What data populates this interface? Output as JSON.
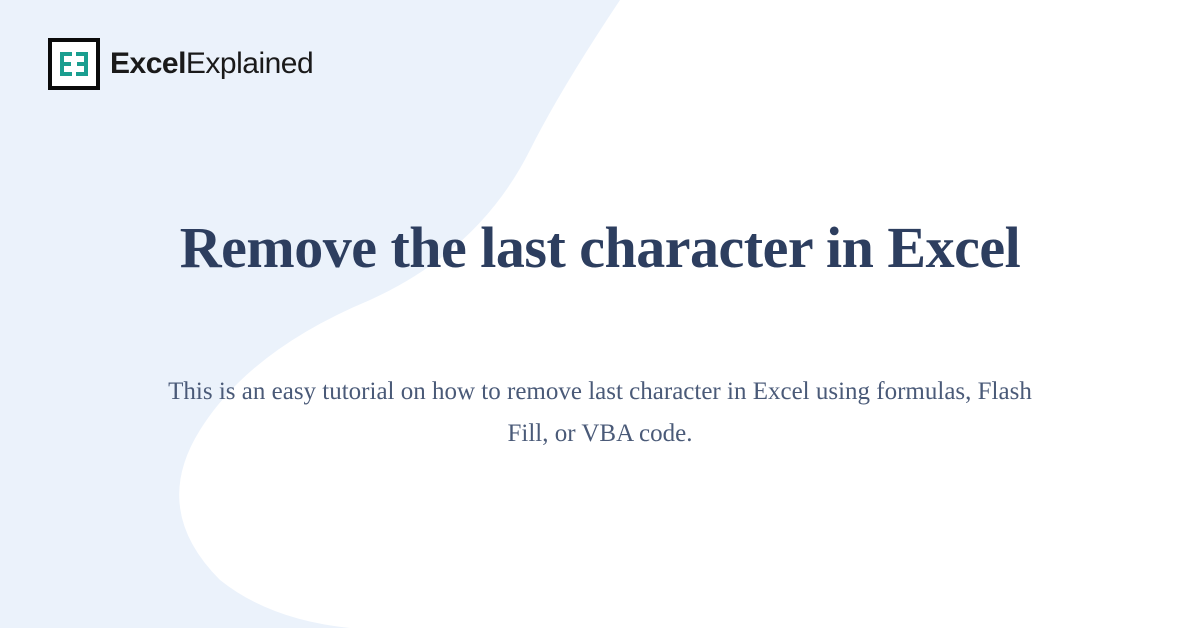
{
  "logo": {
    "brand_bold": "Excel",
    "brand_light": "Explained",
    "icon_name": "excel-explained-logo"
  },
  "title": "Remove the last character in Excel",
  "subtitle": "This is an easy tutorial on how to remove last character in Excel using formulas, Flash Fill, or VBA code.",
  "colors": {
    "bg_light_blue": "#ebf2fb",
    "text_dark": "#2d3e5f",
    "text_sub": "#4a5a78",
    "logo_teal": "#1a9e8f"
  }
}
